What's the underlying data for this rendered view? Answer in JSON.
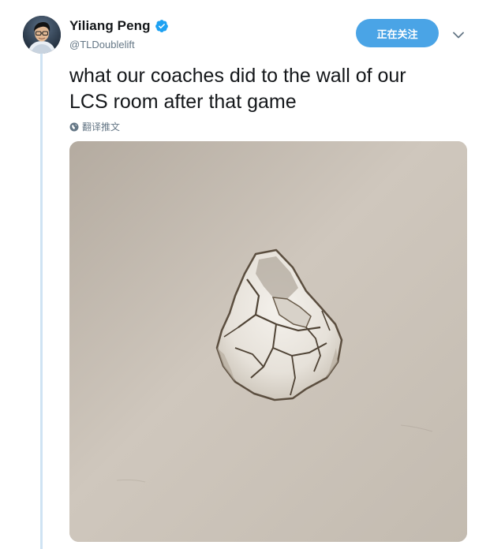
{
  "user": {
    "display_name": "Yiliang Peng",
    "handle": "@TLDoublelift",
    "verified": true
  },
  "follow_button": {
    "label": "正在关注"
  },
  "tweet": {
    "text": "what our coaches did to the wall of our\nLCS room after that game",
    "translate_label": "翻译推文"
  },
  "colors": {
    "accent": "#4aa4e6",
    "thread_line": "#cfe3f3",
    "text_primary": "#14171a",
    "text_secondary": "#657786",
    "wall": "#c9c1b7"
  },
  "icons": {
    "verified": "verified-badge-icon",
    "caret": "chevron-down-icon",
    "translate": "globe-icon"
  }
}
